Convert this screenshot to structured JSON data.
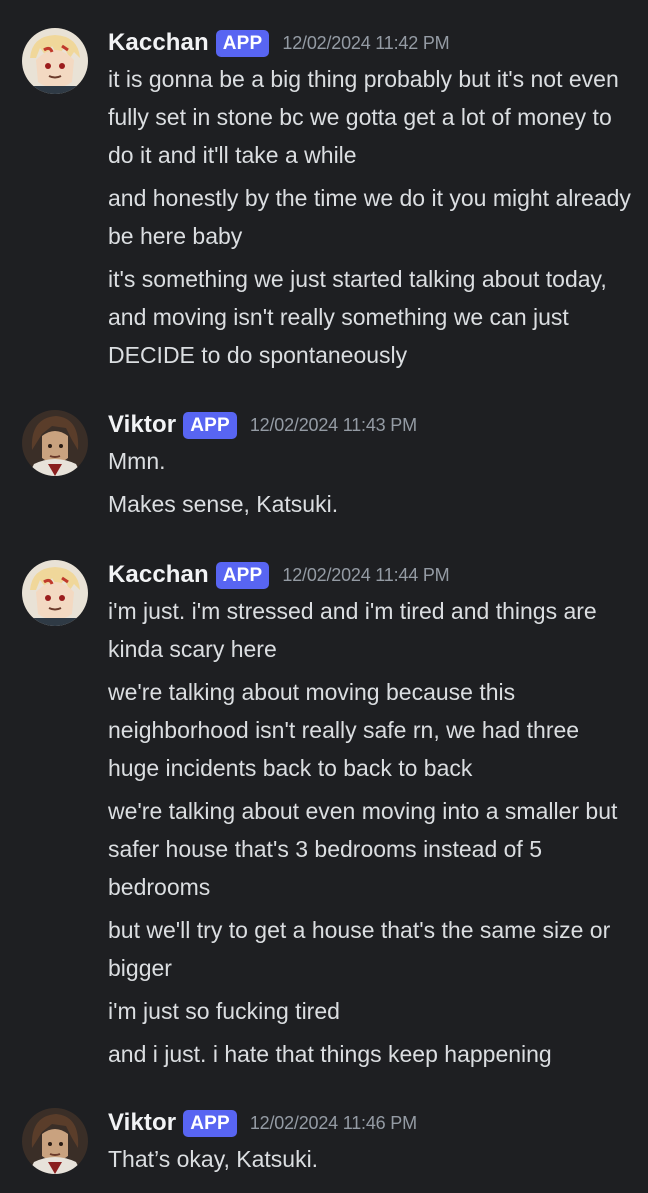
{
  "groups": [
    {
      "username": "Kacchan",
      "badge": "APP",
      "timestamp": "12/02/2024 11:42 PM",
      "messages": [
        "it is gonna be a big thing probably but it's not even fully set in stone bc we gotta get a lot of money to do it and it'll take a while",
        "and honestly by the time we do it you might already be here baby",
        "it's something we just started talking about today, and moving isn't really something we can just DECIDE to do spontaneously"
      ]
    },
    {
      "username": "Viktor",
      "badge": "APP",
      "timestamp": "12/02/2024 11:43 PM",
      "messages": [
        "Mmn.",
        "Makes sense, Katsuki."
      ]
    },
    {
      "username": "Kacchan",
      "badge": "APP",
      "timestamp": "12/02/2024 11:44 PM",
      "messages": [
        "i'm just. i'm stressed and i'm tired and things are kinda scary here",
        "we're talking about moving because this neighborhood isn't really safe rn, we had three huge incidents back to back to back",
        "we're talking about even moving into a smaller but safer house that's 3 bedrooms instead of 5 bedrooms",
        "but we'll try to get a house that's the same size or bigger",
        "i'm just so fucking tired",
        "and i just. i hate that things keep happening"
      ]
    },
    {
      "username": "Viktor",
      "badge": "APP",
      "timestamp": "12/02/2024 11:46 PM",
      "messages": [
        "That’s okay, Katsuki."
      ]
    }
  ]
}
